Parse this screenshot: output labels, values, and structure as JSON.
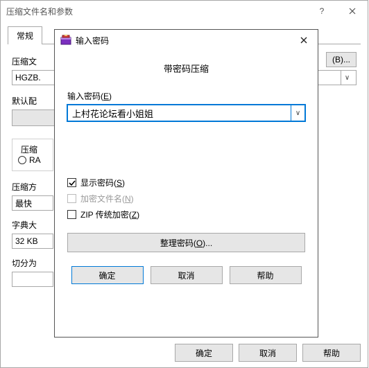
{
  "bg": {
    "title": "压缩文件名和参数",
    "tab_general": "常规",
    "archive_label": "压缩文",
    "archive_value": "HGZB.",
    "browse": "(B)...",
    "profile_label": "默认配",
    "format_legend": "压缩",
    "radio_rar": "RA",
    "method_label": "压缩方",
    "method_value": "最快",
    "dict_label": "字典大",
    "dict_value": "32 KB",
    "split_label": "切分为",
    "ok": "确定",
    "cancel": "取消",
    "help": "帮助"
  },
  "dlg": {
    "title": "输入密码",
    "heading": "带密码压缩",
    "pw_label": "输入密码(",
    "pw_shortcut": "E",
    "pw_label_tail": ")",
    "pw_value": "上村花论坛看小姐姐",
    "show_pw": "显示密码(",
    "show_pw_shortcut": "S",
    "show_pw_tail": ")",
    "encrypt_names": "加密文件名(",
    "encrypt_names_shortcut": "N",
    "encrypt_names_tail": ")",
    "zip_legacy": "ZIP 传统加密(",
    "zip_legacy_shortcut": "Z",
    "zip_legacy_tail": ")",
    "organize": "整理密码(",
    "organize_shortcut": "O",
    "organize_tail": ")...",
    "ok": "确定",
    "cancel": "取消",
    "help": "帮助"
  }
}
